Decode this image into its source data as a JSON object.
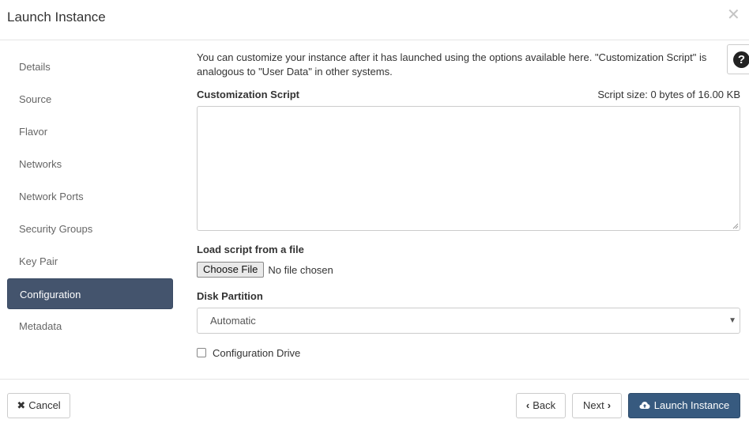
{
  "modal": {
    "title": "Launch Instance"
  },
  "sidebar": {
    "items": [
      {
        "label": "Details"
      },
      {
        "label": "Source"
      },
      {
        "label": "Flavor"
      },
      {
        "label": "Networks"
      },
      {
        "label": "Network Ports"
      },
      {
        "label": "Security Groups"
      },
      {
        "label": "Key Pair"
      },
      {
        "label": "Configuration",
        "active": true
      },
      {
        "label": "Metadata"
      }
    ]
  },
  "main": {
    "intro_line1": "You can customize your instance after it has launched using the options available here. \"Customization Script\" is",
    "intro_line2": "analogous to \"User Data\" in other systems.",
    "script_label": "Customization Script",
    "script_size": "Script size: 0 bytes of 16.00 KB",
    "script_value": "",
    "load_label": "Load script from a file",
    "choose_file": "Choose File",
    "no_file": "No file chosen",
    "disk_label": "Disk Partition",
    "disk_value": "Automatic",
    "config_drive_label": "Configuration Drive",
    "config_drive_checked": false
  },
  "footer": {
    "cancel": "Cancel",
    "back": "Back",
    "next": "Next",
    "launch": "Launch Instance"
  },
  "icons": {
    "close": "close-icon",
    "help": "question-circle-icon",
    "cancel": "times-icon",
    "back": "chevron-left-icon",
    "next": "chevron-right-icon",
    "launch": "cloud-upload-icon",
    "select": "caret-down-icon"
  },
  "colors": {
    "active_nav": "#44546d",
    "primary_button": "#375a7f"
  }
}
